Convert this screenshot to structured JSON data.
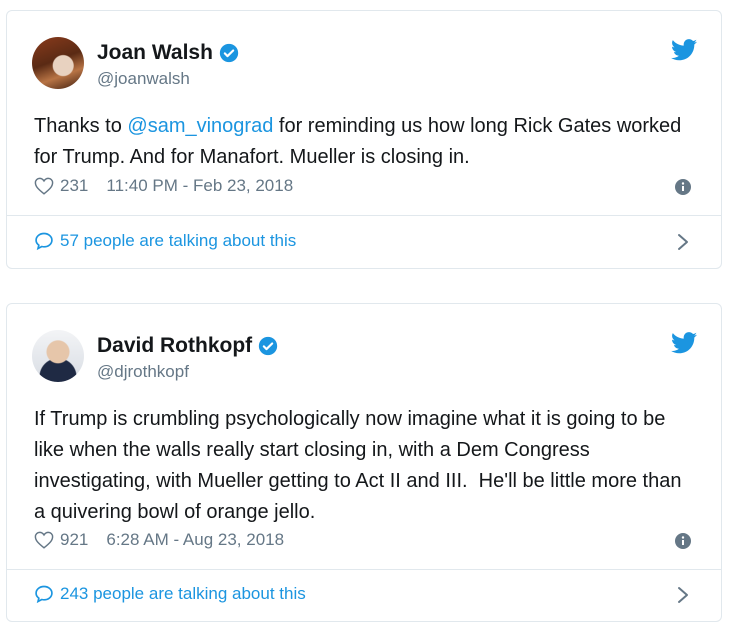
{
  "tweets": [
    {
      "name": "Joan Walsh",
      "handle": "@joanwalsh",
      "text_before": "Thanks to ",
      "mention": "@sam_vinograd",
      "text_after": " for reminding us how long Rick Gates worked for Trump. And for Manafort. Mueller is closing in.",
      "likes": "231",
      "timestamp": "11:40 PM - Feb 23, 2018",
      "talking": "57 people are talking about this"
    },
    {
      "name": "David Rothkopf",
      "handle": "@djrothkopf",
      "text": "If Trump is crumbling psychologically now imagine what it is going to be like when the walls really start closing in, with a Dem Congress investigating, with Mueller getting to Act II and III.  He'll be little more than a quivering bowl of orange jello.",
      "likes": "921",
      "timestamp": "6:28 AM - Aug 23, 2018",
      "talking": "243 people are talking about this"
    }
  ],
  "colors": {
    "accent": "#1b95e0",
    "text": "#14171a",
    "muted": "#657786",
    "border": "#e1e8ed"
  },
  "icons": [
    "verified-icon",
    "twitter-bird-icon",
    "heart-icon",
    "info-icon",
    "reply-bubble-icon",
    "chevron-right-icon"
  ]
}
